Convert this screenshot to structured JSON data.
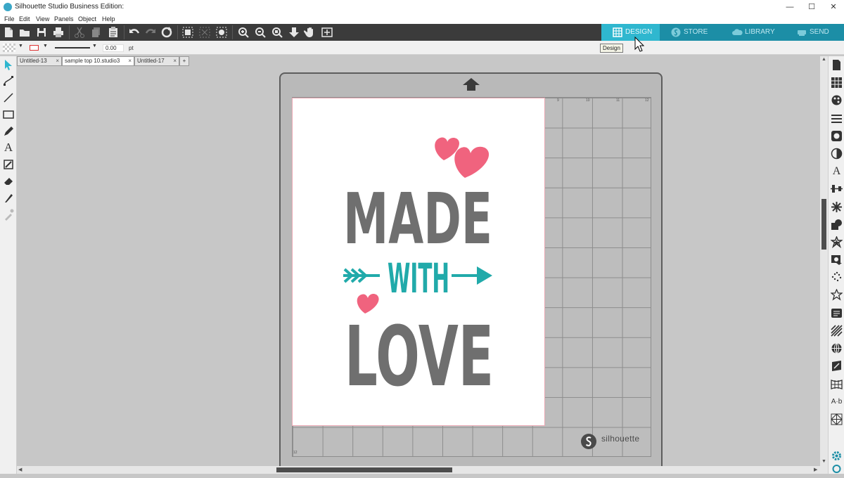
{
  "app": {
    "title": "Silhouette Studio Business Edition:"
  },
  "window_buttons": {
    "minimize": "—",
    "maximize": "☐",
    "close": "✕"
  },
  "menu": [
    "File",
    "Edit",
    "View",
    "Panels",
    "Object",
    "Help"
  ],
  "nav_tabs": [
    {
      "label": "DESIGN",
      "active": true
    },
    {
      "label": "STORE",
      "active": false
    },
    {
      "label": "LIBRARY",
      "active": false
    },
    {
      "label": "SEND",
      "active": false
    }
  ],
  "tooltip": "Design",
  "properties": {
    "line_width": "0.00",
    "unit": "pt"
  },
  "doc_tabs": [
    {
      "label": "Untitled-13",
      "close": "×",
      "active": false
    },
    {
      "label": "sample top 10.studio3",
      "close": "×",
      "active": true
    },
    {
      "label": "Untitled-17",
      "close": "×",
      "active": false
    }
  ],
  "add_tab": "+",
  "ruler": {
    "top": [
      "9",
      "10",
      "11",
      "12"
    ],
    "bottom": "12"
  },
  "design": {
    "line1": "MADE",
    "line2": "WITH",
    "line3": "LOVE"
  },
  "mat_brand": "silhouette",
  "colors": {
    "accent": "#2fb7cf",
    "nav_dark": "#1c8ea6",
    "toolbar": "#3b3b3b",
    "heart": "#f0637e",
    "teal": "#21aaaa",
    "gray_text": "#6f6f6f"
  }
}
